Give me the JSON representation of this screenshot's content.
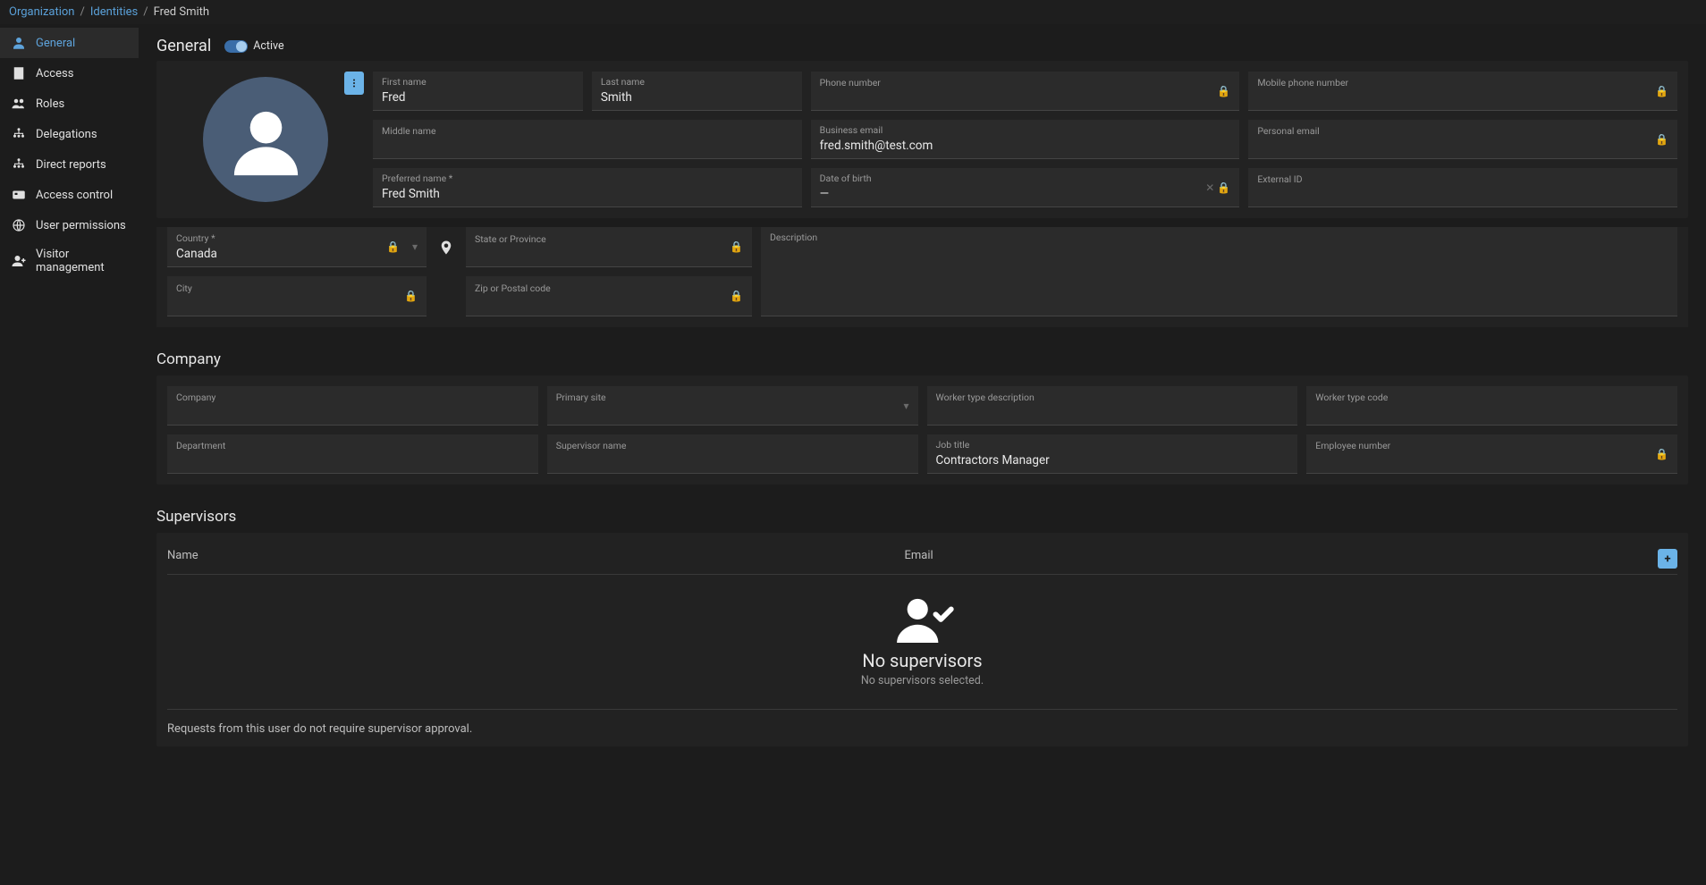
{
  "breadcrumb": {
    "org": "Organization",
    "identities": "Identities",
    "current": "Fred Smith"
  },
  "sidebar": {
    "items": [
      {
        "label": "General",
        "icon": "person",
        "active": true
      },
      {
        "label": "Access",
        "icon": "building",
        "active": false
      },
      {
        "label": "Roles",
        "icon": "users",
        "active": false
      },
      {
        "label": "Delegations",
        "icon": "tree",
        "active": false
      },
      {
        "label": "Direct reports",
        "icon": "tree",
        "active": false
      },
      {
        "label": "Access control",
        "icon": "card",
        "active": false
      },
      {
        "label": "User permissions",
        "icon": "globe",
        "active": false
      },
      {
        "label": "Visitor management",
        "icon": "user-plus",
        "active": false
      }
    ]
  },
  "general": {
    "title": "General",
    "active_label": "Active",
    "fields": {
      "first_name": {
        "label": "First name",
        "value": "Fred"
      },
      "last_name": {
        "label": "Last name",
        "value": "Smith"
      },
      "phone": {
        "label": "Phone number",
        "value": ""
      },
      "mobile": {
        "label": "Mobile phone number",
        "value": ""
      },
      "middle_name": {
        "label": "Middle name",
        "value": ""
      },
      "business_email": {
        "label": "Business email",
        "value": "fred.smith@test.com"
      },
      "personal_email": {
        "label": "Personal email",
        "value": ""
      },
      "preferred_name": {
        "label": "Preferred name *",
        "value": "Fred Smith"
      },
      "dob": {
        "label": "Date of birth",
        "value": "—"
      },
      "external_id": {
        "label": "External ID",
        "value": ""
      },
      "country": {
        "label": "Country *",
        "value": "Canada"
      },
      "state": {
        "label": "State or Province",
        "value": ""
      },
      "description": {
        "label": "Description",
        "value": ""
      },
      "city": {
        "label": "City",
        "value": ""
      },
      "zip": {
        "label": "Zip or Postal code",
        "value": ""
      }
    }
  },
  "company": {
    "title": "Company",
    "fields": {
      "company": {
        "label": "Company",
        "value": ""
      },
      "primary_site": {
        "label": "Primary site",
        "value": ""
      },
      "worker_type_desc": {
        "label": "Worker type description",
        "value": ""
      },
      "worker_type_code": {
        "label": "Worker type code",
        "value": ""
      },
      "department": {
        "label": "Department",
        "value": ""
      },
      "supervisor_name": {
        "label": "Supervisor name",
        "value": ""
      },
      "job_title": {
        "label": "Job title",
        "value": "Contractors Manager"
      },
      "employee_number": {
        "label": "Employee number",
        "value": ""
      }
    }
  },
  "supervisors": {
    "title": "Supervisors",
    "columns": {
      "name": "Name",
      "email": "Email"
    },
    "empty_title": "No supervisors",
    "empty_sub": "No supervisors selected.",
    "note": "Requests from this user do not require supervisor approval."
  }
}
